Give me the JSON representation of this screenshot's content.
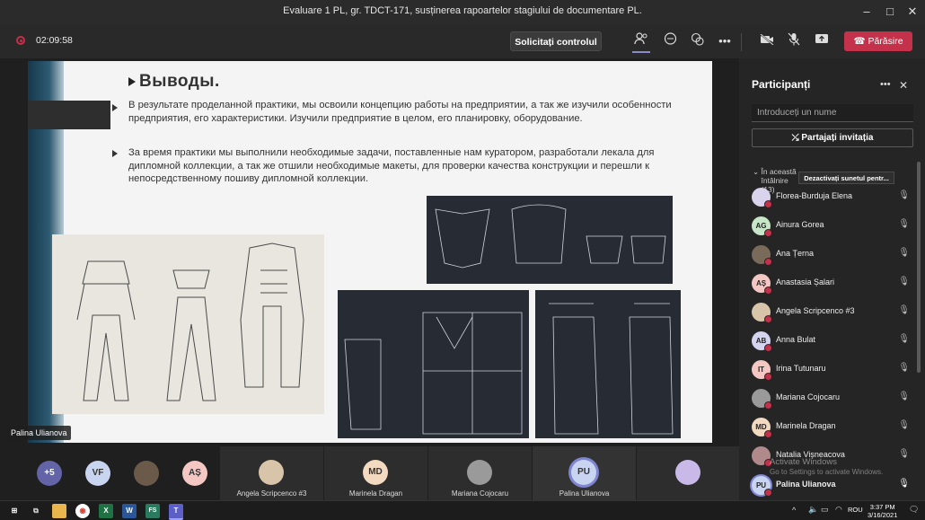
{
  "window": {
    "title": "Evaluare 1 PL, gr. TDCT-171, susținerea rapoartelor stagiului de documentare PL."
  },
  "toolbar": {
    "timer": "02:09:58",
    "request_control": "Solicitați controlul",
    "leave": "Părăsire"
  },
  "slide": {
    "heading": "Выводы.",
    "paragraph1": "В результате проделанной практики, мы освоили концепцию работы на предприятии, а так же изучили особенности предприятия, его характеристики. Изучили предприятие в целом, его планировку, оборудование.",
    "paragraph2": "За время практики мы выполнили необходимые задачи, поставленные нам куратором, разработали лекала для дипломной коллекции, а так же отшили необходимые макеты, для проверки качества конструкции и перешли к непосредственному пошиву дипломной коллекции."
  },
  "presenter_label": "Palina Ulianova",
  "gallery": {
    "overflow": "+5",
    "circles": [
      {
        "initials": "VF",
        "color": "#c9d4f0"
      },
      {
        "initials": "",
        "color": "#6b5a4a"
      },
      {
        "initials": "AȘ",
        "color": "#f4c7c3"
      }
    ],
    "tiles": [
      {
        "name": "Angela Scripcenco #3",
        "initials": "",
        "color": "#d8c4a8"
      },
      {
        "name": "Marinela Dragan",
        "initials": "MD",
        "color": "#f3d9c0"
      },
      {
        "name": "Mariana Cojocaru",
        "initials": "",
        "color": "#9a9a9a"
      },
      {
        "name": "Palina Ulianova",
        "initials": "PU",
        "color": "#c9d4f0"
      },
      {
        "name": "",
        "initials": "",
        "color": "#c8b9e8"
      }
    ]
  },
  "panel": {
    "title": "Participanți",
    "search_placeholder": "Introduceți un nume",
    "invite": "Partajați invitația",
    "section": "În această întâlnire (13)",
    "mute_all": "Dezactivați sunetul pentr...",
    "participants": [
      {
        "name": "Florea-Burduja Elena",
        "initials": "",
        "color": "#d9d3ee"
      },
      {
        "name": "Ainura Gorea",
        "initials": "AG",
        "color": "#c7e6c8"
      },
      {
        "name": "Ana Țerna",
        "initials": "",
        "color": "#7a6a5a"
      },
      {
        "name": "Anastasia Șalari",
        "initials": "AȘ",
        "color": "#f4c7c3"
      },
      {
        "name": "Angela Scripcenco #3",
        "initials": "",
        "color": "#d8c4a8"
      },
      {
        "name": "Anna Bulat",
        "initials": "AB",
        "color": "#d4d4f0"
      },
      {
        "name": "Irina Tutunaru",
        "initials": "IT",
        "color": "#f4c7c3"
      },
      {
        "name": "Mariana Cojocaru",
        "initials": "",
        "color": "#9a9a9a"
      },
      {
        "name": "Marinela Dragan",
        "initials": "MD",
        "color": "#f3d9c0"
      },
      {
        "name": "Natalia Vișneacova",
        "initials": "",
        "color": "#b08a8a"
      },
      {
        "name": "Palina Ulianova",
        "initials": "PU",
        "color": "#c9d4f0"
      }
    ]
  },
  "watermark": {
    "line1": "Activate Windows",
    "line2": "Go to Settings to activate Windows."
  },
  "taskbar": {
    "lang": "ROU",
    "time": "3:37 PM",
    "date": "3/16/2021"
  }
}
